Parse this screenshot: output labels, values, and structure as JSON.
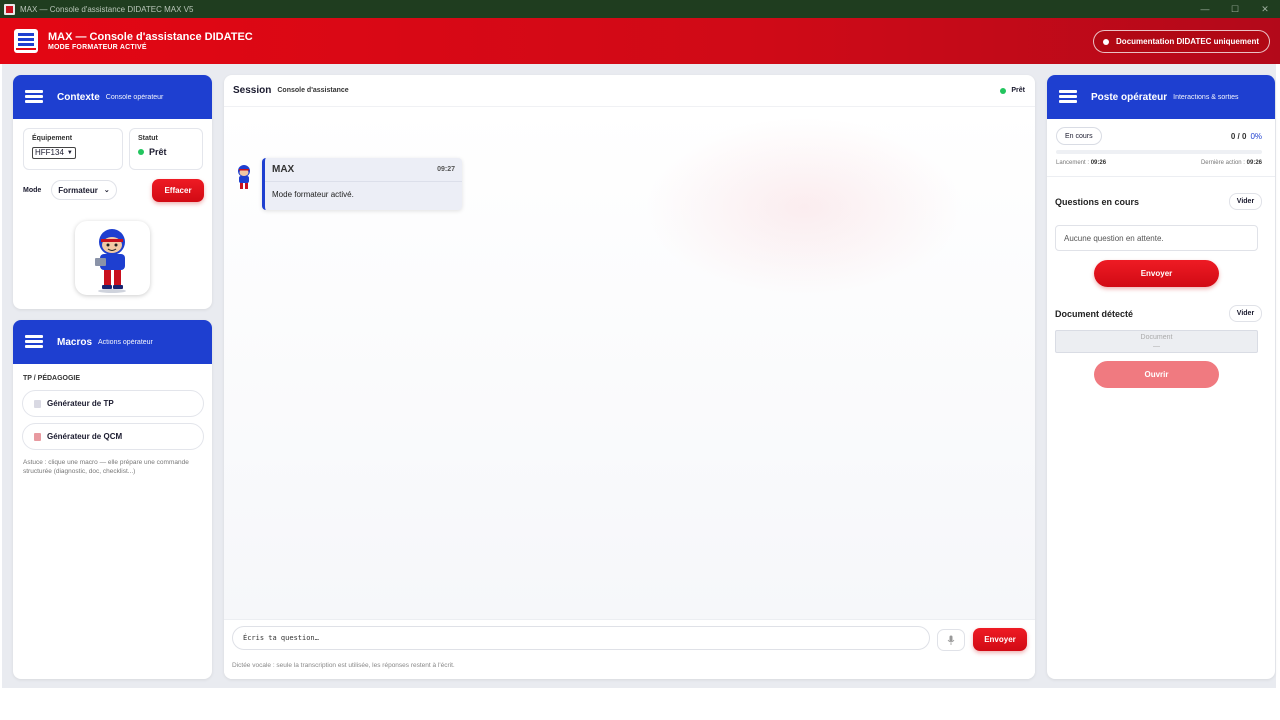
{
  "window": {
    "title": "MAX — Console d'assistance DIDATEC MAX V5",
    "controls": [
      "—",
      "☐",
      "✕"
    ]
  },
  "header": {
    "title": "MAX — Console d'assistance DIDATEC",
    "subtitle": "MODE FORMATEUR ACTIVÉ",
    "doc_pill": "Documentation DIDATEC uniquement",
    "colors": {
      "primary_red": "#e30613",
      "brand_blue": "#1e3fd0"
    }
  },
  "context": {
    "title": "Contexte",
    "subtitle": "Console opérateur",
    "equipment_label": "Équipement",
    "equipment_value": "HFF134",
    "status_label": "Statut",
    "status_value": "Prêt",
    "mode_label": "Mode",
    "mode_value": "Formateur",
    "clear_button": "Effacer"
  },
  "macros": {
    "title": "Macros",
    "subtitle": "Actions opérateur",
    "section": "TP / PÉDAGOGIE",
    "items": [
      {
        "label": "Générateur de TP",
        "icon": "document-icon"
      },
      {
        "label": "Générateur de QCM",
        "icon": "quiz-icon"
      }
    ],
    "tip": "Astuce : clique une macro — elle prépare une commande structurée (diagnostic, doc, checklist...)"
  },
  "session": {
    "title": "Session",
    "subtitle": "Console d'assistance",
    "status": "Prêt",
    "messages": [
      {
        "author": "MAX",
        "time": "09:27",
        "text": "Mode formateur activé."
      }
    ],
    "input_placeholder": "Écris ta question…",
    "send_button": "Envoyer",
    "hint": "Dictée vocale : seule la transcription est utilisée, les réponses restent à l'écrit."
  },
  "poste": {
    "title": "Poste opérateur",
    "subtitle": "Interactions & sorties",
    "state": "En cours",
    "counter": "0 / 0",
    "percent": "0%",
    "progress": 0,
    "launch_label": "Lancement :",
    "launch_time": "09:26",
    "last_label": "Dernière action :",
    "last_time": "09:26",
    "questions_title": "Questions en cours",
    "clear1": "Vider",
    "no_questions": "Aucune question en attente.",
    "send_button": "Envoyer",
    "document_title": "Document détecté",
    "clear2": "Vider",
    "document_label": "Document",
    "document_value": "—",
    "open_button": "Ouvrir"
  }
}
